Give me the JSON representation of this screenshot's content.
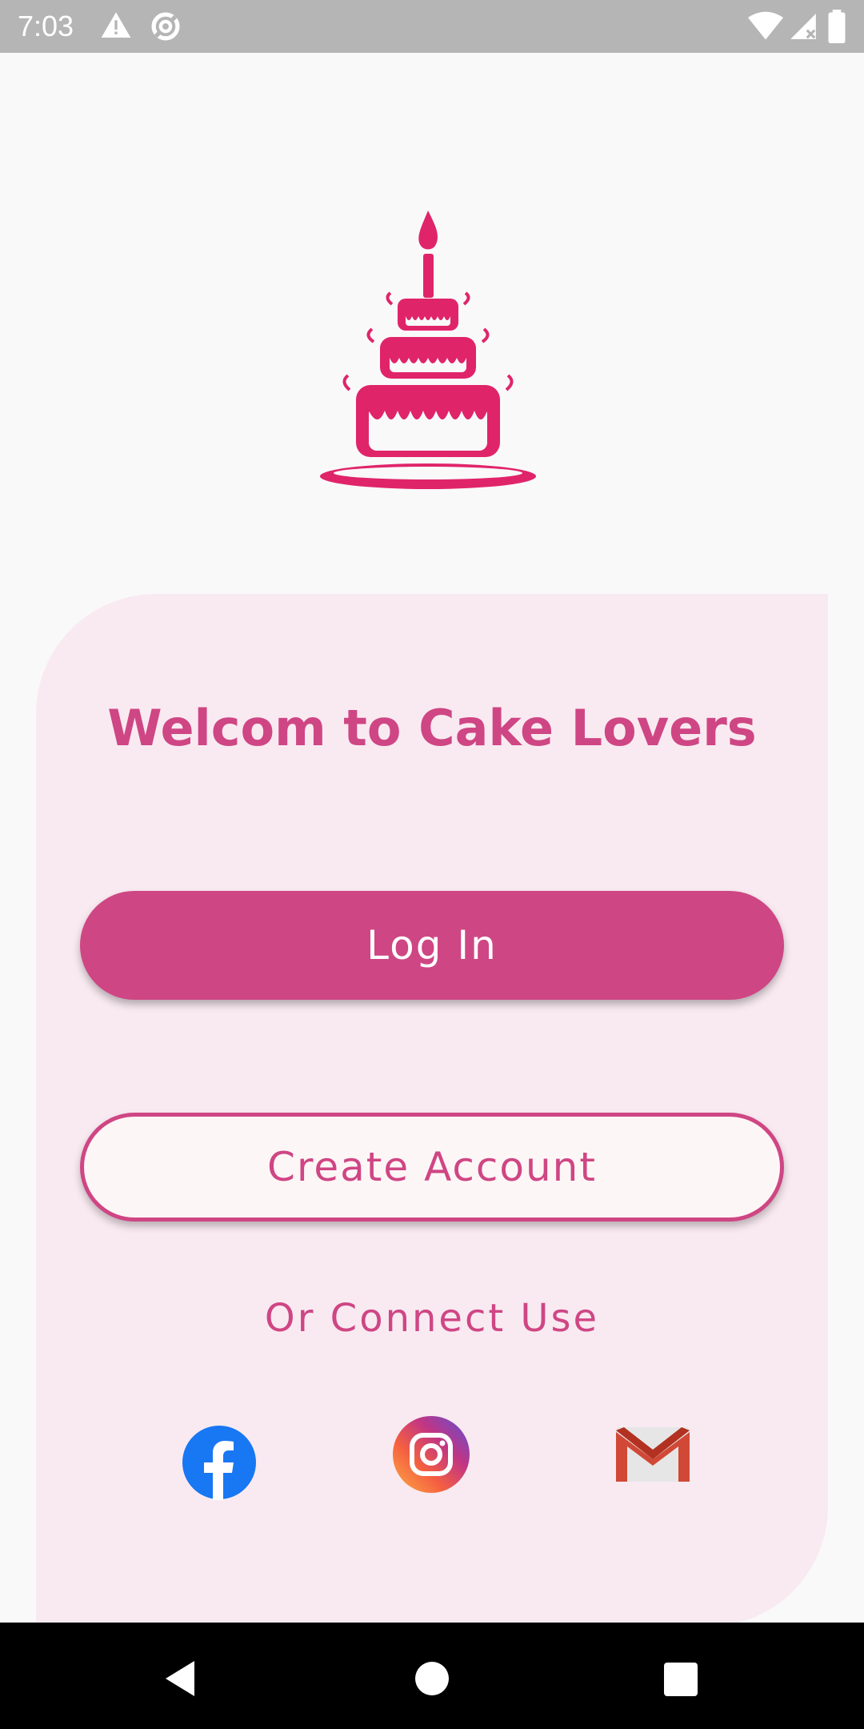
{
  "status_bar": {
    "time": "7:03",
    "icons": [
      "warning-icon",
      "data-saver-icon",
      "wifi-icon",
      "signal-icon",
      "battery-icon"
    ]
  },
  "logo": {
    "icon": "birthday-cake-icon",
    "color": "#e0246a"
  },
  "welcome": {
    "title": "Welcom to Cake Lovers"
  },
  "buttons": {
    "login_label": "Log In",
    "create_label": "Create Account"
  },
  "connect": {
    "label": "Or Connect Use",
    "providers": [
      "facebook-icon",
      "instagram-icon",
      "gmail-icon"
    ]
  },
  "nav": {
    "icons": [
      "back-icon",
      "home-icon",
      "recents-icon"
    ]
  },
  "colors": {
    "accent": "#cf4684",
    "card_bg": "#f9eaf1",
    "page_bg": "#f9f9f9",
    "facebook": "#1877f2",
    "gmail": "#d14836"
  }
}
